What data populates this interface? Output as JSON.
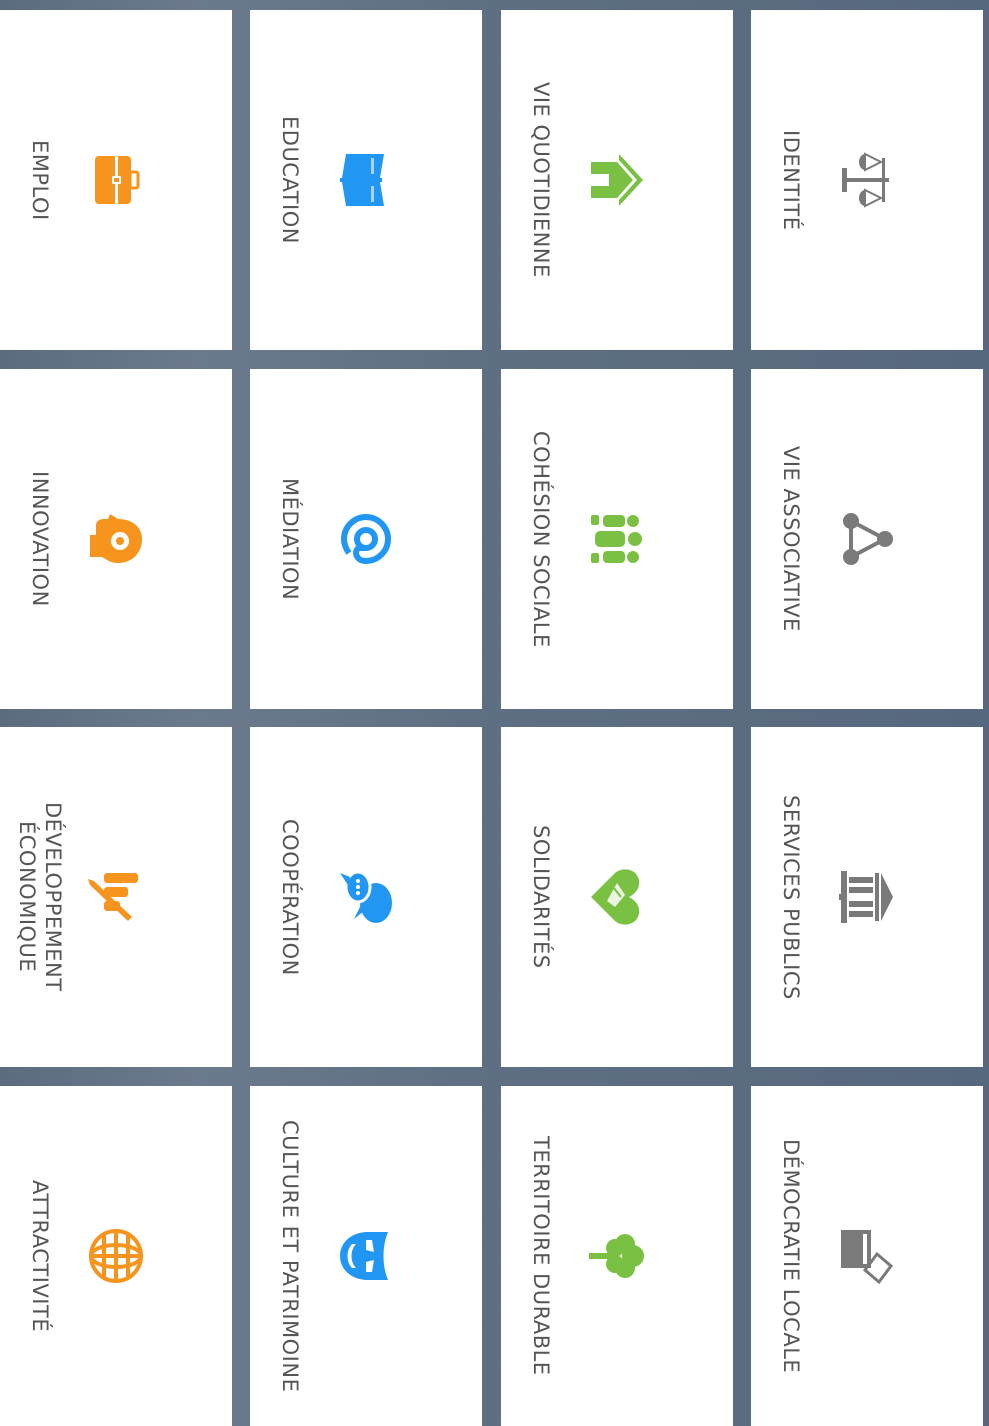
{
  "tiles": [
    {
      "label": "EMPLOI",
      "icon": "briefcase-icon",
      "color": "#f7941d"
    },
    {
      "label": "EDUCATION",
      "icon": "book-icon",
      "color": "#2196f3"
    },
    {
      "label": "VIE QUOTIDIENNE",
      "icon": "home-icon",
      "color": "#7ac143"
    },
    {
      "label": "IDENTITÉ",
      "icon": "scales-icon",
      "color": "#7a7a7a"
    },
    {
      "label": "INNOVATION",
      "icon": "head-gear-icon",
      "color": "#f7941d"
    },
    {
      "label": "MÉDIATION",
      "icon": "at-sign-icon",
      "color": "#2196f3"
    },
    {
      "label": "COHÉSION SOCIALE",
      "icon": "group-icon",
      "color": "#7ac143"
    },
    {
      "label": "VIE ASSOCIATIVE",
      "icon": "network-icon",
      "color": "#7a7a7a"
    },
    {
      "label": "DÉVELOPPEMENT ÉCONOMIQUE",
      "icon": "chart-pen-icon",
      "color": "#f7941d"
    },
    {
      "label": "COOPÉRATION",
      "icon": "speech-bubbles-icon",
      "color": "#2196f3"
    },
    {
      "label": "SOLIDARITÉS",
      "icon": "handshake-heart-icon",
      "color": "#7ac143"
    },
    {
      "label": "SERVICES PUBLICS",
      "icon": "public-building-icon",
      "color": "#7a7a7a"
    },
    {
      "label": "ATTRACTIVITÉ",
      "icon": "globe-icon",
      "color": "#f7941d"
    },
    {
      "label": "CULTURE ET PATRIMOINE",
      "icon": "theatre-mask-icon",
      "color": "#2196f3"
    },
    {
      "label": "TERRITOIRE DURABLE",
      "icon": "tree-icon",
      "color": "#7ac143"
    },
    {
      "label": "DÉMOCRATIE LOCALE",
      "icon": "ballot-box-icon",
      "color": "#7a7a7a"
    }
  ]
}
